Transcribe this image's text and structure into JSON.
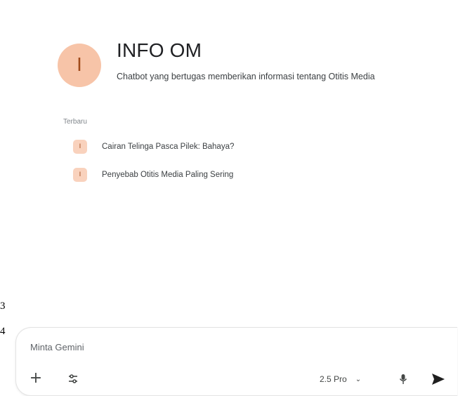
{
  "gem": {
    "avatar_letter": "I",
    "title": "INFO OM",
    "description": "Chatbot yang bertugas memberikan informasi tentang Otitis Media",
    "accent_color": "#f7c4a8"
  },
  "recent": {
    "label": "Terbaru",
    "items": [
      {
        "icon_letter": "I",
        "title": "Cairan Telinga Pasca Pilek: Bahaya?"
      },
      {
        "icon_letter": "I",
        "title": "Penyebab Otitis Media Paling Sering"
      }
    ]
  },
  "line_numbers": [
    "3",
    "4"
  ],
  "composer": {
    "placeholder": "Minta Gemini",
    "model_label": "2.5 Pro",
    "icons": [
      "plus-icon",
      "tools-icon",
      "chevron-down-icon",
      "mic-icon",
      "send-icon"
    ]
  }
}
